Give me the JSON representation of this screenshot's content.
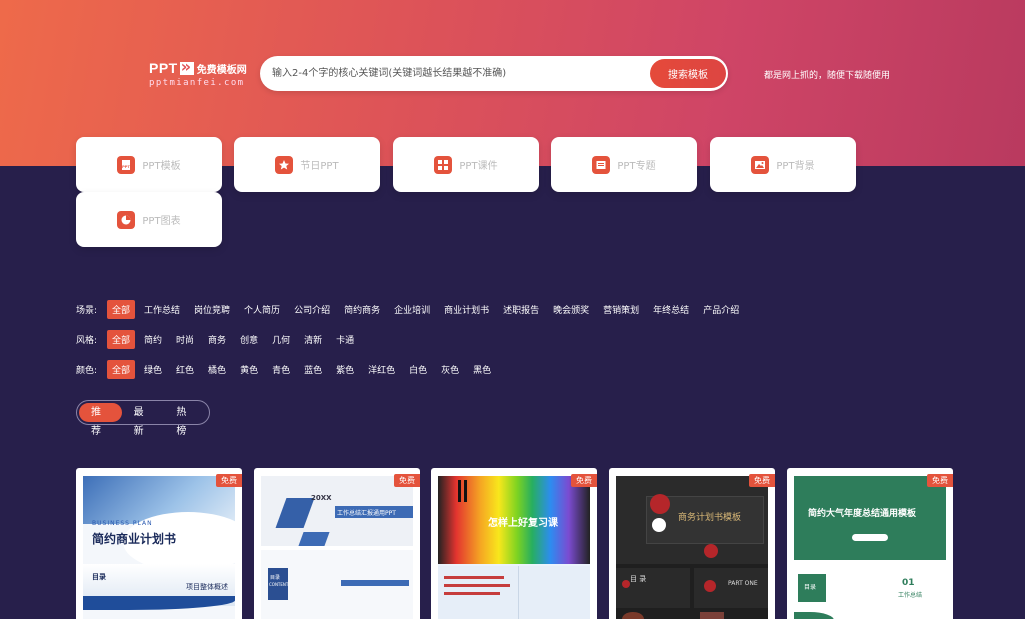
{
  "logo": {
    "brand": "PPT",
    "cn": "免费模板网",
    "url": "pptmianfei.com"
  },
  "search": {
    "placeholder": "输入2-4个字的核心关键词(关键词越长结果越不准确)",
    "button": "搜索模板"
  },
  "hero_note": "都是网上抓的，随便下载随便用",
  "categories": [
    {
      "label": "PPT模板",
      "icon": "ppt-file-icon"
    },
    {
      "label": "节日PPT",
      "icon": "star-icon"
    },
    {
      "label": "PPT课件",
      "icon": "grid-icon"
    },
    {
      "label": "PPT专题",
      "icon": "book-icon"
    },
    {
      "label": "PPT背景",
      "icon": "image-icon"
    },
    {
      "label": "PPT图表",
      "icon": "pie-chart-icon"
    }
  ],
  "filters": {
    "scene": {
      "key": "场景:",
      "items": [
        "全部",
        "工作总结",
        "岗位竞聘",
        "个人简历",
        "公司介绍",
        "简约商务",
        "企业培训",
        "商业计划书",
        "述职报告",
        "晚会颁奖",
        "营销策划",
        "年终总结",
        "产品介绍"
      ]
    },
    "style": {
      "key": "风格:",
      "items": [
        "全部",
        "简约",
        "时尚",
        "商务",
        "创意",
        "几何",
        "清新",
        "卡通"
      ]
    },
    "color": {
      "key": "颜色:",
      "items": [
        "全部",
        "绿色",
        "红色",
        "橘色",
        "黄色",
        "青色",
        "蓝色",
        "紫色",
        "洋红色",
        "白色",
        "灰色",
        "黑色"
      ]
    }
  },
  "sort_tabs": [
    "推荐",
    "最新",
    "热榜"
  ],
  "templates": [
    {
      "badge": "免费",
      "t1": "BUSINESS PLAN",
      "t2": "简约商业计划书",
      "t3": "目录",
      "t4": "项目整体概述"
    },
    {
      "badge": "免费",
      "t1": "20XX",
      "t2": "工作总结汇报通用PPT",
      "t3": "目录",
      "t4": "CONTENT"
    },
    {
      "badge": "免费",
      "t1": "怎样上好复习课"
    },
    {
      "badge": "免费",
      "t1": "商务计划书模板",
      "t2": "目 录",
      "t3": "PART ONE"
    },
    {
      "badge": "免费",
      "t1": "简约大气年度总结通用模板",
      "t2": "目录",
      "t3": "01",
      "t4": "工作总结"
    }
  ],
  "colors": {
    "accent": "#e4533c",
    "background": "#271f4b",
    "hero_start": "#ee6a4a",
    "hero_end": "#b93a5f"
  }
}
